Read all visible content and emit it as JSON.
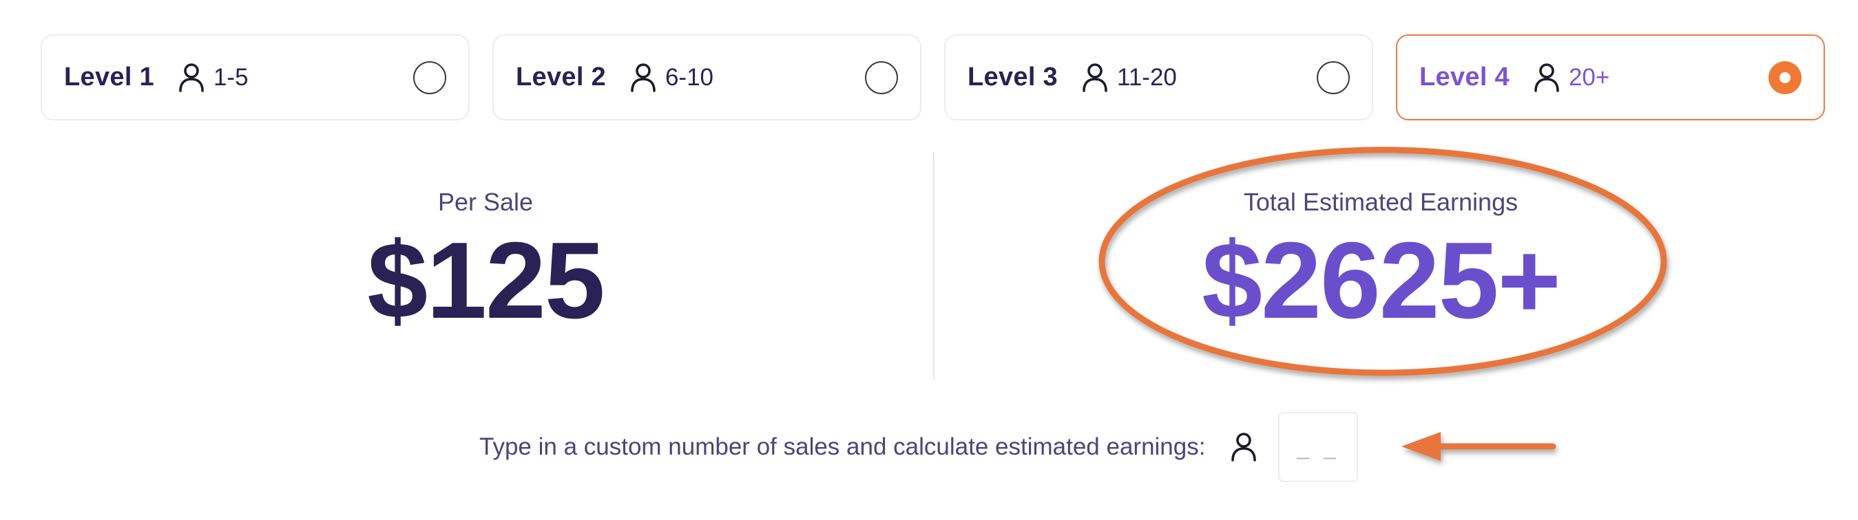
{
  "levels": [
    {
      "label": "Level 1",
      "range": "1-5",
      "selected": false
    },
    {
      "label": "Level 2",
      "range": "6-10",
      "selected": false
    },
    {
      "label": "Level 3",
      "range": "11-20",
      "selected": false
    },
    {
      "label": "Level 4",
      "range": "20+",
      "selected": true
    }
  ],
  "per_sale": {
    "label": "Per Sale",
    "value": "$125"
  },
  "total": {
    "label": "Total Estimated Earnings",
    "value": "$2625+"
  },
  "custom": {
    "label": "Type in a custom number of sales and calculate estimated earnings:",
    "placeholder": "_ _",
    "value": ""
  },
  "icons": {
    "level_icon": "person-icon",
    "custom_icon": "person-icon"
  },
  "colors": {
    "dark_text": "#2a2255",
    "accent_purple": "#6a4fcc",
    "selected_orange": "#ee7a3e",
    "annotation_orange": "#e8743b"
  }
}
